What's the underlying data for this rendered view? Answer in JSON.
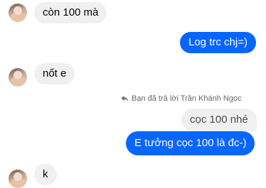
{
  "messages": [
    {
      "text": "còn 100 mà"
    },
    {
      "text": "Log trc chj=)"
    },
    {
      "text": "nốt e"
    },
    {
      "text": "cọc 100 nhé"
    },
    {
      "text": "E tưởng cọc 100 là đc-)"
    },
    {
      "text": "k"
    }
  ],
  "reply_note": "Bạn đã trả lời Trần Khánh Ngọc",
  "colors": {
    "outgoing": "#0866ff",
    "incoming": "#f0f0f0",
    "meta": "#65676b"
  }
}
